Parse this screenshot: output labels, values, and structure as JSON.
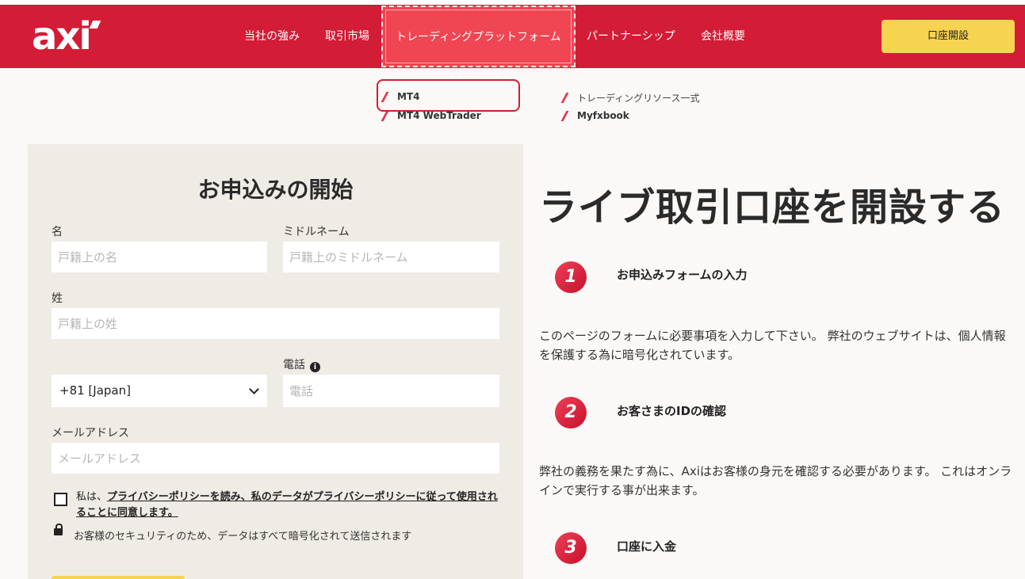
{
  "header": {
    "logo": "axi",
    "nav": [
      {
        "label": "当社の強み"
      },
      {
        "label": "取引市場"
      },
      {
        "label": "トレーディングプラットフォーム"
      },
      {
        "label": "パートナーシップ"
      },
      {
        "label": "会社概要"
      }
    ],
    "cta_label": "口座開設"
  },
  "dropdown": {
    "items": [
      {
        "label": "MT4"
      },
      {
        "label": "MT4 WebTrader"
      },
      {
        "label": "トレーディングリソース一式"
      },
      {
        "label": "Myfxbook"
      }
    ]
  },
  "form": {
    "title": "お申込みの開始",
    "first_name": {
      "label": "名",
      "placeholder": "戸籍上の名"
    },
    "middle_name": {
      "label": "ミドルネーム",
      "placeholder": "戸籍上のミドルネーム"
    },
    "last_name": {
      "label": "姓",
      "placeholder": "戸籍上の姓"
    },
    "country_code": {
      "value": "+81 [Japan]"
    },
    "phone": {
      "label": "電話",
      "placeholder": "電話",
      "info": "i"
    },
    "email": {
      "label": "メールアドレス",
      "placeholder": "メールアドレス"
    },
    "consent_prefix": "私は、",
    "consent_link": "プライバシーポリシーを読み、私のデータがプライバシーポリシーに従って使用されることに同意します。",
    "security_note": "お客様のセキュリティのため、データはすべて暗号化されて送信されます"
  },
  "right": {
    "hero_title": "ライブ取引口座を開設する",
    "steps": [
      {
        "number": "1",
        "title": "お申込みフォームの入力",
        "desc": "このページのフォームに必要事項を入力して下さい。 弊社のウェブサイトは、個人情報を保護する為に暗号化されています。"
      },
      {
        "number": "2",
        "title": "お客さまのIDの確認",
        "desc": "弊社の義務を果たす為に、Axiはお客様の身元を確認する必要があります。 これはオンラインで実行する事が出来ます。"
      },
      {
        "number": "3",
        "title": "口座に入金",
        "desc": ""
      }
    ]
  },
  "colors": {
    "brand_red": "#d31c35",
    "accent_yellow": "#f7d352",
    "active_tab": "#f04553"
  }
}
